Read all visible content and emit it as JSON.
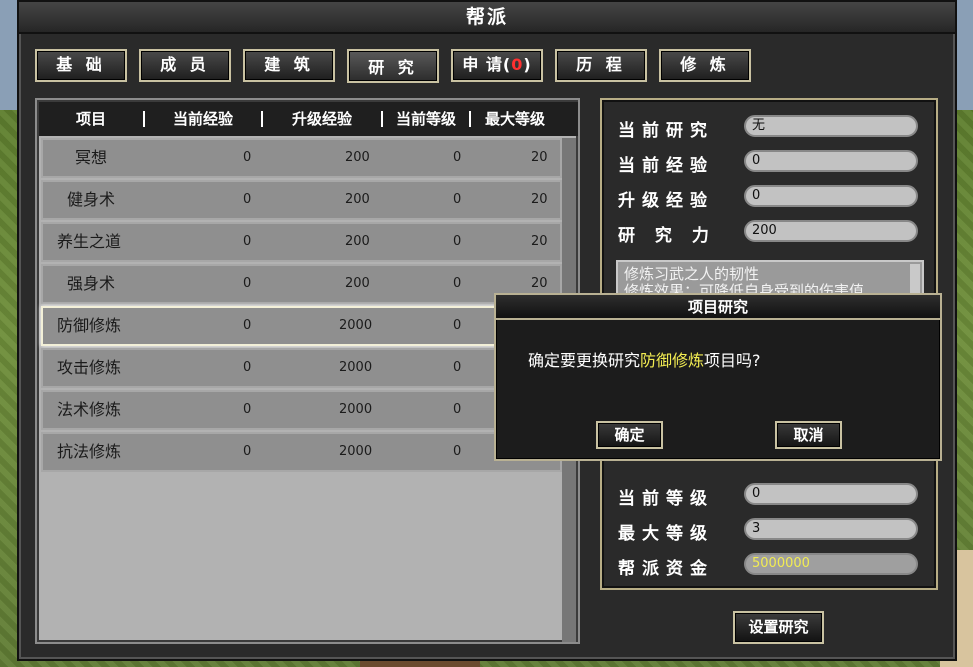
{
  "window": {
    "title": "帮派"
  },
  "tabs": [
    {
      "label": "基 础"
    },
    {
      "label": "成 员"
    },
    {
      "label": "建 筑"
    },
    {
      "label": "研 究"
    },
    {
      "label_prefix": "申 请(",
      "badge": "0",
      "label_suffix": ")"
    },
    {
      "label": "历 程"
    },
    {
      "label": "修 炼"
    }
  ],
  "table": {
    "headers": [
      "项目",
      "当前经验",
      "升级经验",
      "当前等级",
      "最大等级"
    ],
    "rows": [
      {
        "name": "冥想",
        "cur_exp": "0",
        "up_exp": "200",
        "cur_lv": "0",
        "max_lv": "20"
      },
      {
        "name": "健身术",
        "cur_exp": "0",
        "up_exp": "200",
        "cur_lv": "0",
        "max_lv": "20"
      },
      {
        "name": "养生之道",
        "cur_exp": "0",
        "up_exp": "200",
        "cur_lv": "0",
        "max_lv": "20"
      },
      {
        "name": "强身术",
        "cur_exp": "0",
        "up_exp": "200",
        "cur_lv": "0",
        "max_lv": "20"
      },
      {
        "name": "防御修炼",
        "cur_exp": "0",
        "up_exp": "2000",
        "cur_lv": "0",
        "max_lv": ""
      },
      {
        "name": "攻击修炼",
        "cur_exp": "0",
        "up_exp": "2000",
        "cur_lv": "0",
        "max_lv": ""
      },
      {
        "name": "法术修炼",
        "cur_exp": "0",
        "up_exp": "2000",
        "cur_lv": "0",
        "max_lv": ""
      },
      {
        "name": "抗法修炼",
        "cur_exp": "0",
        "up_exp": "2000",
        "cur_lv": "0",
        "max_lv": ""
      }
    ]
  },
  "info": {
    "current_research_label": "当前研究",
    "current_research_value": "无",
    "current_exp_label": "当前经验",
    "current_exp_value": "0",
    "upgrade_exp_label": "升级经验",
    "upgrade_exp_value": "0",
    "research_power_label": "研 究 力",
    "research_power_value": "200",
    "description_line1": "修炼习武之人的韧性",
    "description_line2": "修炼效果：可降低自身受到的伤害值",
    "current_level_label": "当前等级",
    "current_level_value": "0",
    "max_level_label": "最大等级",
    "max_level_value": "3",
    "gang_funds_label": "帮派资金",
    "gang_funds_value": "5000000"
  },
  "set_research_button": "设置研究",
  "dialog": {
    "title": "项目研究",
    "message_prefix": "确定要更换研究",
    "message_highlight": "防御修炼",
    "message_suffix": "项目吗?",
    "confirm": "确定",
    "cancel": "取消"
  },
  "colors": {
    "highlight": "#f2ec52",
    "badge": "#ff3030",
    "border_gold": "#c9c2a2"
  }
}
